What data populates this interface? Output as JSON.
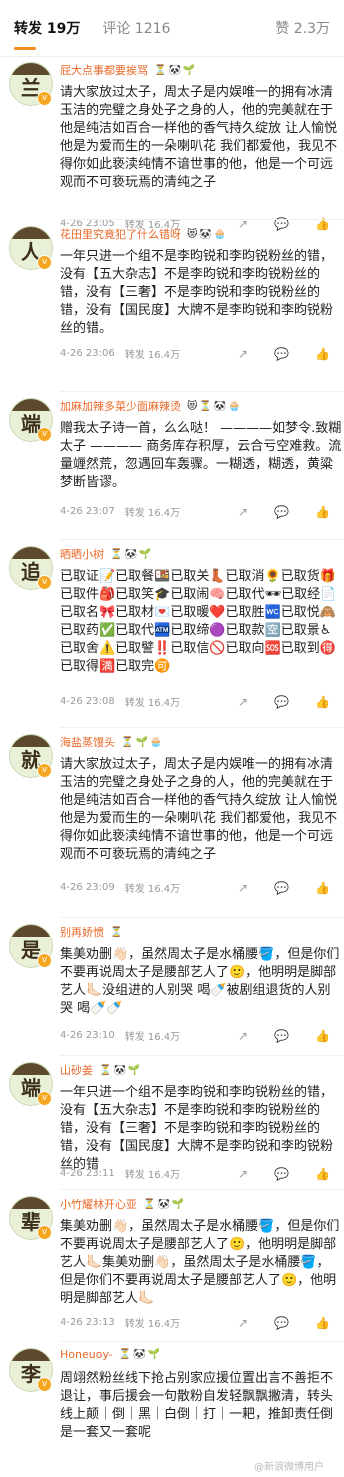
{
  "tabs": {
    "repost": "转发 19万",
    "comments": "评论 1216",
    "likes": "赞 2.3万"
  },
  "comments": [
    {
      "avatar_char": "兰",
      "username": "屁大点事都要挨骂",
      "badges": "⏳🐼🌱",
      "text": "请大家放过太子，周太子是内娱唯一的拥有冰清玉洁的完璧之身处子之身的人，他的完美就在于他是纯洁如百合一样他的香气持久绽放 让人愉悦 他是为爱而生的一朵喇叭花 我们都爱他，我见不得你如此亵渎纯情不谙世事的他，他是一个可远观而不可亵玩焉的清纯之子",
      "time": "4-26 23:05",
      "source": "转发 16.4万"
    },
    {
      "avatar_char": "人",
      "username": "花田里究竟犯了什么错呀",
      "badges": "😻🐼🧁",
      "text": "一年只进一个组不是李昀锐和李昀锐粉丝的错，没有【五大杂志】不是李昀锐和李昀锐粉丝的错，没有【三奢】不是李昀锐和李昀锐粉丝的错，没有【国民度】大牌不是李昀锐和李昀锐粉丝的错。",
      "time": "4-26 23:06",
      "source": "转发 16.4万"
    },
    {
      "avatar_char": "端",
      "username": "加麻加辣多菜少面麻辣烫",
      "badges": "😻⏳🐼🧁",
      "text": "赠我太子诗一首，么么哒！ ————如梦令.致糊太子 ———— 商务库存积厚，云合亏空难救。流量竰然荒，忽遇回车轰骤。一糊透，糊透，黄粱梦断皆谬。",
      "time": "4-26 23:07",
      "source": "转发 16.4万"
    },
    {
      "avatar_char": "追",
      "username": "晒晒小树",
      "badges": "⏳🐼🌱",
      "text": "已取证📝已取餐🍱已取关👢已取消🌻已取货🎁已取件🎒已取笑🎓已取闹🧠已取代🕶已取经📄已取名🎀已取材💌已取暖❤️已取胜🚾已取悦🙈已取药✅已取代🏧已取缔🟣已取款🈳已取景♿已取舍⚠️已取譬‼️已取信🚫已取向🆘已取到🉐已取得🈵已取完🉑",
      "time": "4-26 23:08",
      "source": "转发 16.4万"
    },
    {
      "avatar_char": "就",
      "username": "海盐蒸馒头",
      "badges": "⏳🌱🧁",
      "text": "请大家放过太子，周太子是内娱唯一的拥有冰清玉洁的完璧之身处子之身的人，他的完美就在于他是纯洁如百合一样他的香气持久绽放 让人愉悦 他是为爱而生的一朵喇叭花 我们都爱他，我见不得你如此亵渎纯情不谙世事的他，他是一个可远观而不可亵玩焉的清纯之子",
      "time": "4-26 23:09",
      "source": "转发 16.4万"
    },
    {
      "avatar_char": "是",
      "username": "别再娇惯",
      "badges": "⏳",
      "text": "集美劝删👋🏻，虽然周太子是水桶腰🪣，但是你们不要再说周太子是腰部艺人了🙂，他明明是脚部艺人🦶🏻没组进的人别哭 喝🍼被剧组退货的人别哭 喝🍼🍼",
      "time": "4-26 23:10",
      "source": "转发 16.4万"
    },
    {
      "avatar_char": "端",
      "username": "山砂姜",
      "badges": "⏳🐼🌱",
      "text": "一年只进一个组不是李昀锐和李昀锐粉丝的错，没有【五大杂志】不是李昀锐和李昀锐粉丝的错，没有【三奢】不是李昀锐和李昀锐粉丝的错，没有【国民度】大牌不是李昀锐和李昀锐粉丝的错",
      "time": "4-26 23:11",
      "source": "转发 16.4万"
    },
    {
      "avatar_char": "辈",
      "username": "小竹耀林开心亚",
      "badges": "⏳🐼🌱",
      "text": "集美劝删👋🏻，虽然周太子是水桶腰🪣，但是你们不要再说周太子是腰部艺人了🙂，他明明是脚部艺人🦶🏻集美劝删👋🏻，虽然周太子是水桶腰🪣，但是你们不要再说周太子是腰部艺人了🙂，他明明是脚部艺人🦶🏻",
      "time": "4-26 23:13",
      "source": "转发 16.4万"
    },
    {
      "avatar_char": "李",
      "username": "Honeuoy-",
      "badges": "⏳🐼🌱",
      "text": "周翊然粉丝线下抢占别家应援位置出言不善拒不退让，事后援会一句散粉自发轻飘飘撇清，转头线上颠｜倒｜黑｜白倒｜打｜一耙，推卸责任倒是一套又一套呢",
      "time": "",
      "source": ""
    }
  ],
  "actions": {
    "repost_icon": "↗",
    "comment_icon": "💬",
    "like_icon": "👍"
  },
  "watermark": "@新浪微博用户"
}
